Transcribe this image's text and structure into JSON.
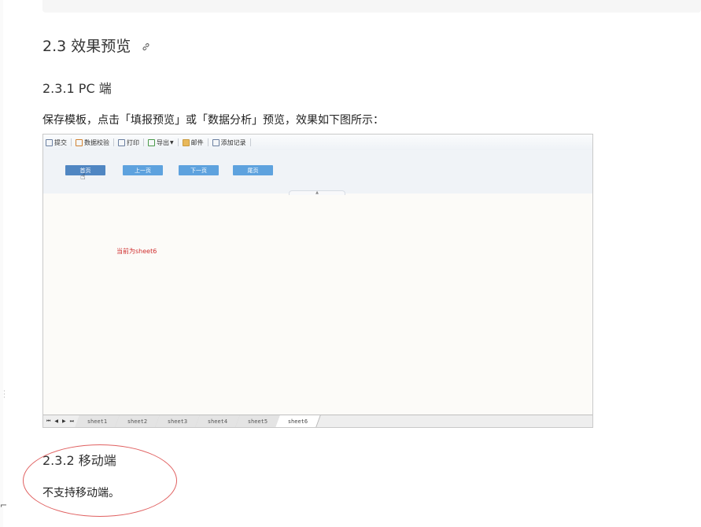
{
  "section": {
    "title": "2.3 效果预览",
    "anchor_icon": "link-icon"
  },
  "pc": {
    "title": "2.3.1 PC 端",
    "description": "保存模板，点击「填报预览」或「数据分析」预览，效果如下图所示："
  },
  "preview": {
    "toolbar": [
      {
        "label": "提交",
        "icon": "save-icon"
      },
      {
        "label": "数据校验",
        "icon": "check-icon"
      },
      {
        "label": "打印",
        "icon": "print-icon"
      },
      {
        "label": "导出",
        "icon": "export-icon",
        "has_dropdown": true
      },
      {
        "label": "邮件",
        "icon": "mail-icon"
      },
      {
        "label": "添加记录",
        "icon": "add-record-icon"
      }
    ],
    "nav_buttons": [
      {
        "label": "首页",
        "active": true
      },
      {
        "label": "上一页",
        "active": false
      },
      {
        "label": "下一页",
        "active": false
      },
      {
        "label": "尾页",
        "active": false
      }
    ],
    "current_sheet_text": "当前为sheet6",
    "tab_nav": [
      "⏮",
      "◀",
      "▶",
      "⏭"
    ],
    "sheets": [
      "sheet1",
      "sheet2",
      "sheet3",
      "sheet4",
      "sheet5",
      "sheet6"
    ],
    "current_sheet": "sheet6",
    "colors": {
      "button": "#5ea2de",
      "button_active": "#5086c2",
      "sheet_text": "#d03030"
    }
  },
  "mobile": {
    "title": "2.3.2 移动端",
    "description": "不支持移动端。",
    "highlight_color": "#e06060"
  }
}
